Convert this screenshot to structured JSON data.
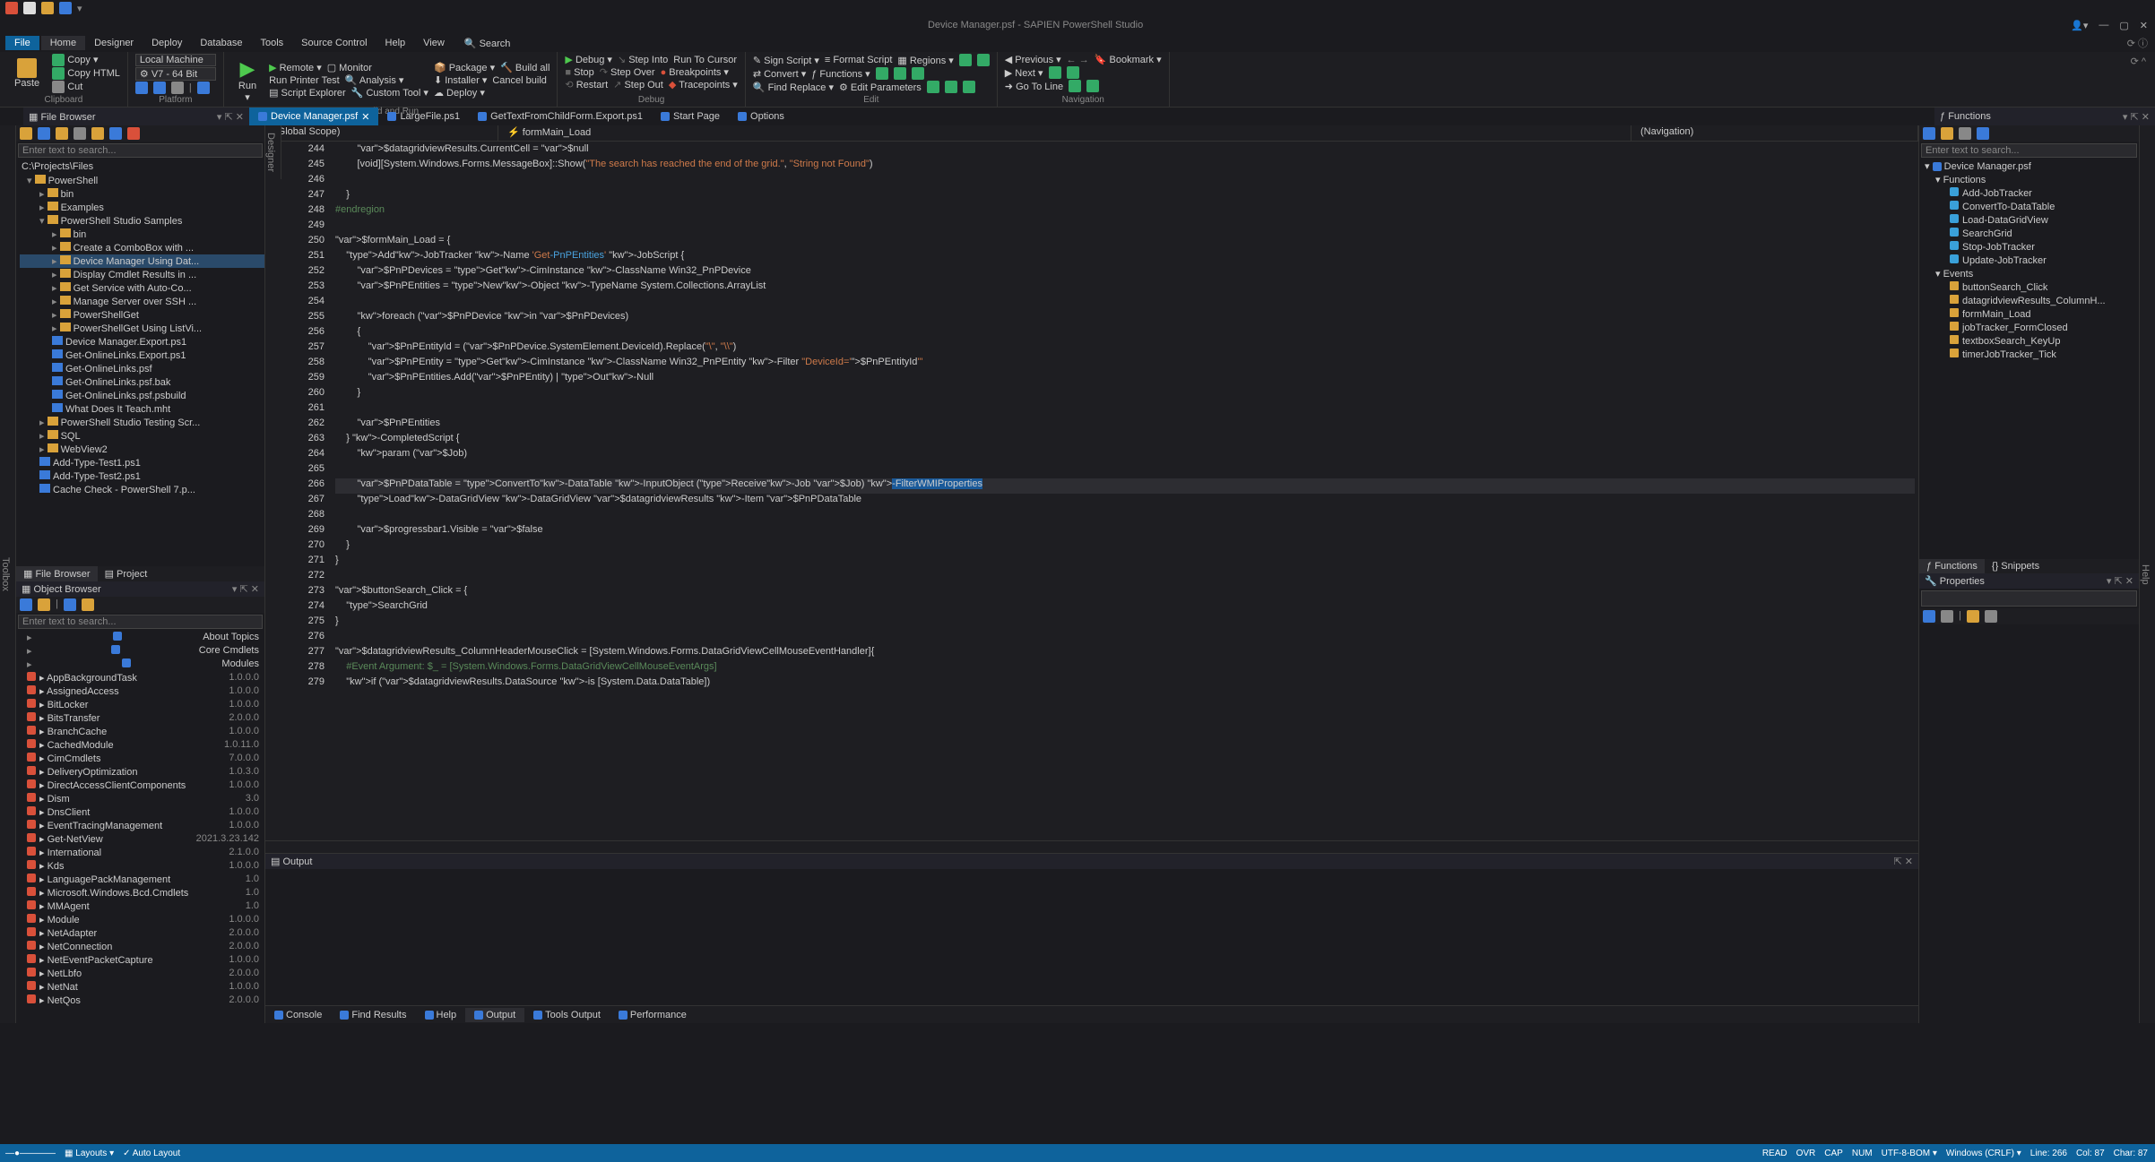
{
  "title": "Device Manager.psf - SAPIEN PowerShell Studio",
  "qat_icons": [
    "app",
    "new",
    "open",
    "save",
    "pin"
  ],
  "menu": {
    "file": "File",
    "tabs": [
      "Home",
      "Designer",
      "Deploy",
      "Database",
      "Tools",
      "Source Control",
      "Help",
      "View"
    ],
    "active": "Home",
    "search": "Search"
  },
  "ribbon": {
    "clipboard": {
      "label": "Clipboard",
      "paste": "Paste",
      "items": [
        "Copy",
        "Copy HTML",
        "Cut"
      ]
    },
    "platform": {
      "label": "Platform",
      "machine": "Local Machine",
      "version": "V7 - 64 Bit"
    },
    "buildrun": {
      "label": "Build and Run",
      "run": "Run",
      "items": [
        [
          "Remote",
          "Monitor"
        ],
        [
          "Run Printer Test",
          "Analysis"
        ],
        [
          "Script Explorer",
          "Custom Tool"
        ]
      ],
      "col2": [
        [
          "Package",
          "Build all"
        ],
        [
          "Installer",
          "Cancel build"
        ],
        [
          "Deploy",
          ""
        ]
      ]
    },
    "debug": {
      "label": "Debug",
      "debug": "Debug",
      "stop": "Stop",
      "restart": "Restart",
      "items": [
        "Step Into",
        "Step Over",
        "Step Out",
        "Run To Cursor",
        "Breakpoints",
        "Tracepoints"
      ]
    },
    "edit": {
      "label": "Edit",
      "items": [
        "Sign Script",
        "Convert",
        "Functions",
        "Format Script",
        "Regions",
        "Find Replace",
        "Edit Parameters"
      ]
    },
    "nav": {
      "label": "Navigation",
      "items": [
        "Previous",
        "Next",
        "Go To Line",
        "Bookmark"
      ]
    }
  },
  "doctabs": {
    "leftpanel": "File Browser",
    "tabs": [
      {
        "label": "Device Manager.psf",
        "active": true,
        "close": true
      },
      {
        "label": "LargeFile.ps1"
      },
      {
        "label": "GetTextFromChildForm.Export.ps1"
      },
      {
        "label": "Start Page"
      },
      {
        "label": "Options"
      }
    ],
    "rightpanel": "Functions"
  },
  "filebrowser": {
    "search": "Enter text to search...",
    "root": "C:\\Projects\\Files",
    "tree": [
      {
        "l": "PowerShell",
        "d": 0,
        "o": true
      },
      {
        "l": "bin",
        "d": 1
      },
      {
        "l": "Examples",
        "d": 1
      },
      {
        "l": "PowerShell Studio Samples",
        "d": 1,
        "o": true
      },
      {
        "l": "bin",
        "d": 2
      },
      {
        "l": "Create a ComboBox with ...",
        "d": 2
      },
      {
        "l": "Device Manager Using Dat...",
        "d": 2,
        "sel": true
      },
      {
        "l": "Display Cmdlet Results in ...",
        "d": 2
      },
      {
        "l": "Get Service with Auto-Co...",
        "d": 2
      },
      {
        "l": "Manage Server over SSH ...",
        "d": 2
      },
      {
        "l": "PowerShellGet",
        "d": 2
      },
      {
        "l": "PowerShellGet Using ListVi...",
        "d": 2
      },
      {
        "l": "Device Manager.Export.ps1",
        "d": 2,
        "f": true
      },
      {
        "l": "Get-OnlineLinks.Export.ps1",
        "d": 2,
        "f": true
      },
      {
        "l": "Get-OnlineLinks.psf",
        "d": 2,
        "f": true
      },
      {
        "l": "Get-OnlineLinks.psf.bak",
        "d": 2,
        "f": true
      },
      {
        "l": "Get-OnlineLinks.psf.psbuild",
        "d": 2,
        "f": true
      },
      {
        "l": "What Does It Teach.mht",
        "d": 2,
        "f": true
      },
      {
        "l": "PowerShell Studio Testing Scr...",
        "d": 1
      },
      {
        "l": "SQL",
        "d": 1
      },
      {
        "l": "WebView2",
        "d": 1
      },
      {
        "l": "Add-Type-Test1.ps1",
        "d": 1,
        "f": true
      },
      {
        "l": "Add-Type-Test2.ps1",
        "d": 1,
        "f": true
      },
      {
        "l": "Cache Check - PowerShell 7.p...",
        "d": 1,
        "f": true
      }
    ],
    "tabs": [
      "File Browser",
      "Project"
    ]
  },
  "objectbrowser": {
    "title": "Object Browser",
    "search": "Enter text to search...",
    "top": [
      "About Topics",
      "Core Cmdlets",
      "Modules"
    ],
    "modules": [
      {
        "n": "AppBackgroundTask",
        "v": "1.0.0.0"
      },
      {
        "n": "AssignedAccess",
        "v": "1.0.0.0"
      },
      {
        "n": "BitLocker",
        "v": "1.0.0.0"
      },
      {
        "n": "BitsTransfer",
        "v": "2.0.0.0"
      },
      {
        "n": "BranchCache",
        "v": "1.0.0.0"
      },
      {
        "n": "CachedModule",
        "v": "1.0.11.0"
      },
      {
        "n": "CimCmdlets",
        "v": "7.0.0.0"
      },
      {
        "n": "DeliveryOptimization",
        "v": "1.0.3.0"
      },
      {
        "n": "DirectAccessClientComponents",
        "v": "1.0.0.0"
      },
      {
        "n": "Dism",
        "v": "3.0"
      },
      {
        "n": "DnsClient",
        "v": "1.0.0.0"
      },
      {
        "n": "EventTracingManagement",
        "v": "1.0.0.0"
      },
      {
        "n": "Get-NetView",
        "v": "2021.3.23.142"
      },
      {
        "n": "International",
        "v": "2.1.0.0"
      },
      {
        "n": "Kds",
        "v": "1.0.0.0"
      },
      {
        "n": "LanguagePackManagement",
        "v": "1.0"
      },
      {
        "n": "Microsoft.Windows.Bcd.Cmdlets",
        "v": "1.0"
      },
      {
        "n": "MMAgent",
        "v": "1.0"
      },
      {
        "n": "Module",
        "v": "1.0.0.0"
      },
      {
        "n": "NetAdapter",
        "v": "2.0.0.0"
      },
      {
        "n": "NetConnection",
        "v": "2.0.0.0"
      },
      {
        "n": "NetEventPacketCapture",
        "v": "1.0.0.0"
      },
      {
        "n": "NetLbfo",
        "v": "2.0.0.0"
      },
      {
        "n": "NetNat",
        "v": "1.0.0.0"
      },
      {
        "n": "NetQos",
        "v": "2.0.0.0"
      }
    ]
  },
  "crumbs": {
    "scope": "(Global Scope)",
    "member": "formMain_Load",
    "nav": "(Navigation)"
  },
  "code_start": 244,
  "code": [
    {
      "t": "        $datagridviewResults.CurrentCell = $null"
    },
    {
      "t": "        [void][System.Windows.Forms.MessageBox]::Show(\"The search has reached the end of the grid.\", \"String not Found\")"
    },
    {
      "t": ""
    },
    {
      "t": "    }"
    },
    {
      "t": "#endregion",
      "cm": true
    },
    {
      "t": ""
    },
    {
      "t": "$formMain_Load = {",
      "fold": true
    },
    {
      "t": "    Add-JobTracker -Name 'Get-PnPEntities' -JobScript {",
      "fold": true
    },
    {
      "t": "        $PnPDevices = Get-CimInstance -ClassName Win32_PnPDevice"
    },
    {
      "t": "        $PnPEntities = New-Object -TypeName System.Collections.ArrayList"
    },
    {
      "t": ""
    },
    {
      "t": "        foreach ($PnPDevice in $PnPDevices)"
    },
    {
      "t": "        {",
      "fold": true
    },
    {
      "t": "            $PnPEntityId = ($PnPDevice.SystemElement.DeviceId).Replace(\"\\\", \"\\\\\")"
    },
    {
      "t": "            $PnPEntity = Get-CimInstance -ClassName Win32_PnPEntity -Filter \"DeviceId='$PnPEntityId'\""
    },
    {
      "t": "            $PnPEntities.Add($PnPEntity) | Out-Null"
    },
    {
      "t": "        }"
    },
    {
      "t": ""
    },
    {
      "t": "        $PnPEntities"
    },
    {
      "t": "    } -CompletedScript {"
    },
    {
      "t": "        param ($Job)"
    },
    {
      "t": ""
    },
    {
      "t": "        $PnPDataTable = ConvertTo-DataTable -InputObject (Receive-Job $Job) -FilterWMIProperties",
      "hl": true,
      "sel": "-FilterWMIProperties"
    },
    {
      "t": "        Load-DataGridView -DataGridView $datagridviewResults -Item $PnPDataTable"
    },
    {
      "t": ""
    },
    {
      "t": "        $progressbar1.Visible = $false"
    },
    {
      "t": "    }"
    },
    {
      "t": "}"
    },
    {
      "t": ""
    },
    {
      "t": "$buttonSearch_Click = {",
      "fold": true
    },
    {
      "t": "    SearchGrid"
    },
    {
      "t": "}"
    },
    {
      "t": ""
    },
    {
      "t": "$datagridviewResults_ColumnHeaderMouseClick = [System.Windows.Forms.DataGridViewCellMouseEventHandler]{",
      "fold": true
    },
    {
      "t": "    #Event Argument: $_ = [System.Windows.Forms.DataGridViewCellMouseEventArgs]",
      "cm": true
    },
    {
      "t": "    if ($datagridviewResults.DataSource -is [System.Data.DataTable])"
    }
  ],
  "output": {
    "title": "Output"
  },
  "bottomtabs": [
    "Console",
    "Find Results",
    "Help",
    "Output",
    "Tools Output",
    "Performance"
  ],
  "bottomtabs_active": "Output",
  "functions": {
    "search": "Enter text to search...",
    "root": "Device Manager.psf",
    "funcs": [
      "Add-JobTracker",
      "ConvertTo-DataTable",
      "Load-DataGridView",
      "SearchGrid",
      "Stop-JobTracker",
      "Update-JobTracker"
    ],
    "events": [
      "buttonSearch_Click",
      "datagridviewResults_ColumnH...",
      "formMain_Load",
      "jobTracker_FormClosed",
      "textboxSearch_KeyUp",
      "timerJobTracker_Tick"
    ],
    "events_label": "Events",
    "funcs_label": "Functions",
    "tabs": [
      "Functions",
      "Snippets"
    ]
  },
  "properties": {
    "title": "Properties"
  },
  "sidelabels": {
    "toolbox": "Toolbox",
    "help": "Help"
  },
  "status": {
    "left": [
      "",
      "Layouts",
      "Auto Layout"
    ],
    "right": [
      "READ",
      "OVR",
      "CAP",
      "NUM",
      "UTF-8-BOM",
      "Windows (CRLF)",
      "Line: 266",
      "Col: 87",
      "Char: 87"
    ]
  }
}
